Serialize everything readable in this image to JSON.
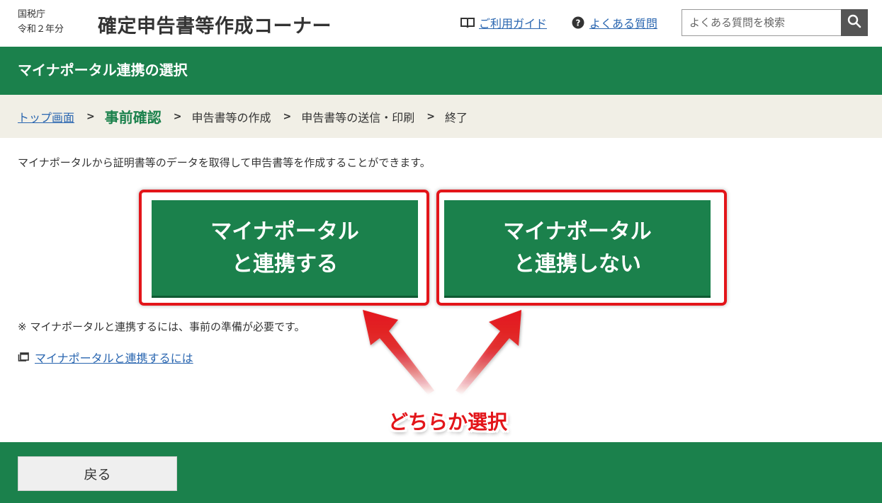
{
  "header": {
    "org_name": "国税庁",
    "fiscal_year": "令和２年分",
    "site_title": "確定申告書等作成コーナー",
    "guide_link": "ご利用ガイド",
    "faq_link": "よくある質問",
    "search_placeholder": "よくある質問を検索"
  },
  "page_title": "マイナポータル連携の選択",
  "breadcrumb": {
    "top": "トップ画面",
    "current": "事前確認",
    "step3": "申告書等の作成",
    "step4": "申告書等の送信・印刷",
    "step5": "終了",
    "separator": ">"
  },
  "intro_text": "マイナポータルから証明書等のデータを取得して申告書等を作成することができます。",
  "choices": {
    "link_line1": "マイナポータル",
    "link_line2": "と連携する",
    "nolink_line1": "マイナポータル",
    "nolink_line2": "と連携しない"
  },
  "note_text": "※  マイナポータルと連携するには、事前の準備が必要です。",
  "mynaportal_link": "マイナポータルと連携するには",
  "annotation": "どちらか選択",
  "footer": {
    "back_label": "戻る"
  },
  "colors": {
    "brand_green": "#1b814c",
    "annotation_red": "#e3151a",
    "link_blue": "#2a66b0",
    "breadcrumb_bg": "#f1efe6"
  },
  "icons": {
    "guide": "book-icon",
    "faq": "question-circle-icon",
    "search": "search-icon",
    "external": "new-window-icon"
  }
}
